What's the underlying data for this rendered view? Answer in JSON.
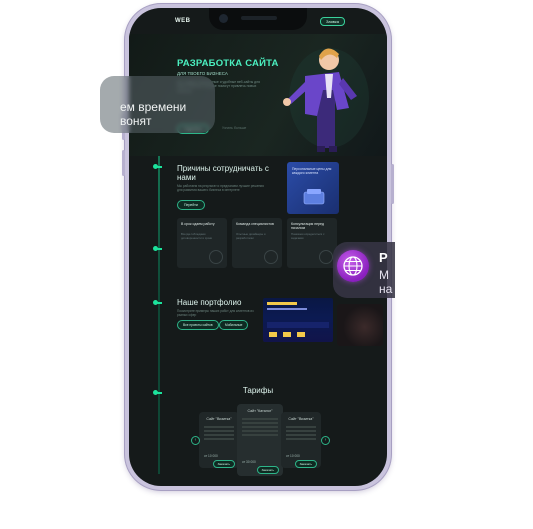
{
  "header": {
    "logo": "WEB",
    "cta": "Заявка"
  },
  "hero": {
    "title": "РАЗРАБОТКА САЙТА",
    "subtitle": "ДЛЯ ТВОЕГО БИЗНЕСА",
    "description": "Мы создаем современные и удобные веб-сайты для вашего бизнеса, которые помогут привлечь новых клиентов",
    "button": "Подробнее",
    "link": "Узнать больше"
  },
  "why": {
    "title": "Причины сотрудничать с нами",
    "description": "Мы работаем на результат и предлагаем лучшие решения для развития вашего бизнеса в интернете",
    "button": "Перейти",
    "blue_card": "Персональные цены для каждого клиента",
    "cards": [
      {
        "title": "В срок сдаем работу",
        "desc": "Всегда соблюдаем договоренности и сроки"
      },
      {
        "title": "Команда специалистов",
        "desc": "Опытные дизайнеры и разработчики"
      },
      {
        "title": "Консультация перед началом",
        "desc": "Поможем определиться с задачами"
      }
    ]
  },
  "portfolio": {
    "title": "Наше портфолио",
    "description": "Посмотрите примеры наших работ для клиентов из разных сфер",
    "button1": "Все проекты сайтов",
    "button2": "Мобильные"
  },
  "tariffs": {
    "title": "Тарифы",
    "cards": [
      {
        "name": "Сайт \"Визитка\"",
        "price": "от 10 000",
        "button": "Заказать"
      },
      {
        "name": "Сайт \"Каталог\"",
        "price": "от 30 000",
        "button": "Заказать"
      },
      {
        "name": "Сайт \"Визитка\"",
        "price": "от 10 000",
        "button": "Заказать"
      }
    ]
  },
  "toast_left": {
    "line1": "ем времени",
    "line2": "вонят"
  },
  "toast_right": {
    "title": "Р",
    "line1": "М",
    "line2": "на"
  },
  "colors": {
    "accent": "#1ce39c",
    "background": "#151a1a",
    "globe": "#a63fd8"
  },
  "icons": {
    "globe": "globe-icon"
  }
}
